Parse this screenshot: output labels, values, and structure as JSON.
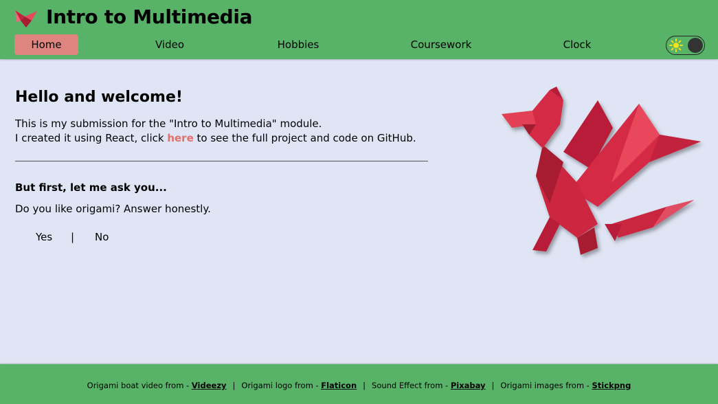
{
  "header": {
    "title": "Intro to Multimedia",
    "nav": [
      {
        "label": "Home",
        "active": true
      },
      {
        "label": "Video",
        "active": false
      },
      {
        "label": "Hobbies",
        "active": false
      },
      {
        "label": "Coursework",
        "active": false
      },
      {
        "label": "Clock",
        "active": false
      }
    ],
    "theme_toggle": {
      "icon": "sun-icon",
      "state": "light"
    }
  },
  "main": {
    "heading": "Hello and welcome!",
    "line1": "This is my submission for the \"Intro to Multimedia\" module.",
    "line2_prefix": "I created it using React, click ",
    "line2_link": "here",
    "line2_suffix": " to see the full project and code on GitHub.",
    "ask_heading": "But first, let me ask you...",
    "question": "Do you like origami? Answer honestly.",
    "answer_yes": "Yes",
    "answer_separator": "|",
    "answer_no": "No",
    "image": "origami-dragon"
  },
  "footer": {
    "credits": [
      {
        "text": "Origami boat video from - ",
        "link": "Videezy"
      },
      {
        "text": "Origami logo from - ",
        "link": "Flaticon"
      },
      {
        "text": "Sound Effect from - ",
        "link": "Pixabay"
      },
      {
        "text": "Origami images from - ",
        "link": "Stickpng"
      }
    ],
    "separator": "|"
  },
  "colors": {
    "header_bg": "#58b368",
    "page_bg": "#dfe5f4",
    "active_tab": "#de8580",
    "link": "#e0716b",
    "dragon": "#d42a44"
  }
}
